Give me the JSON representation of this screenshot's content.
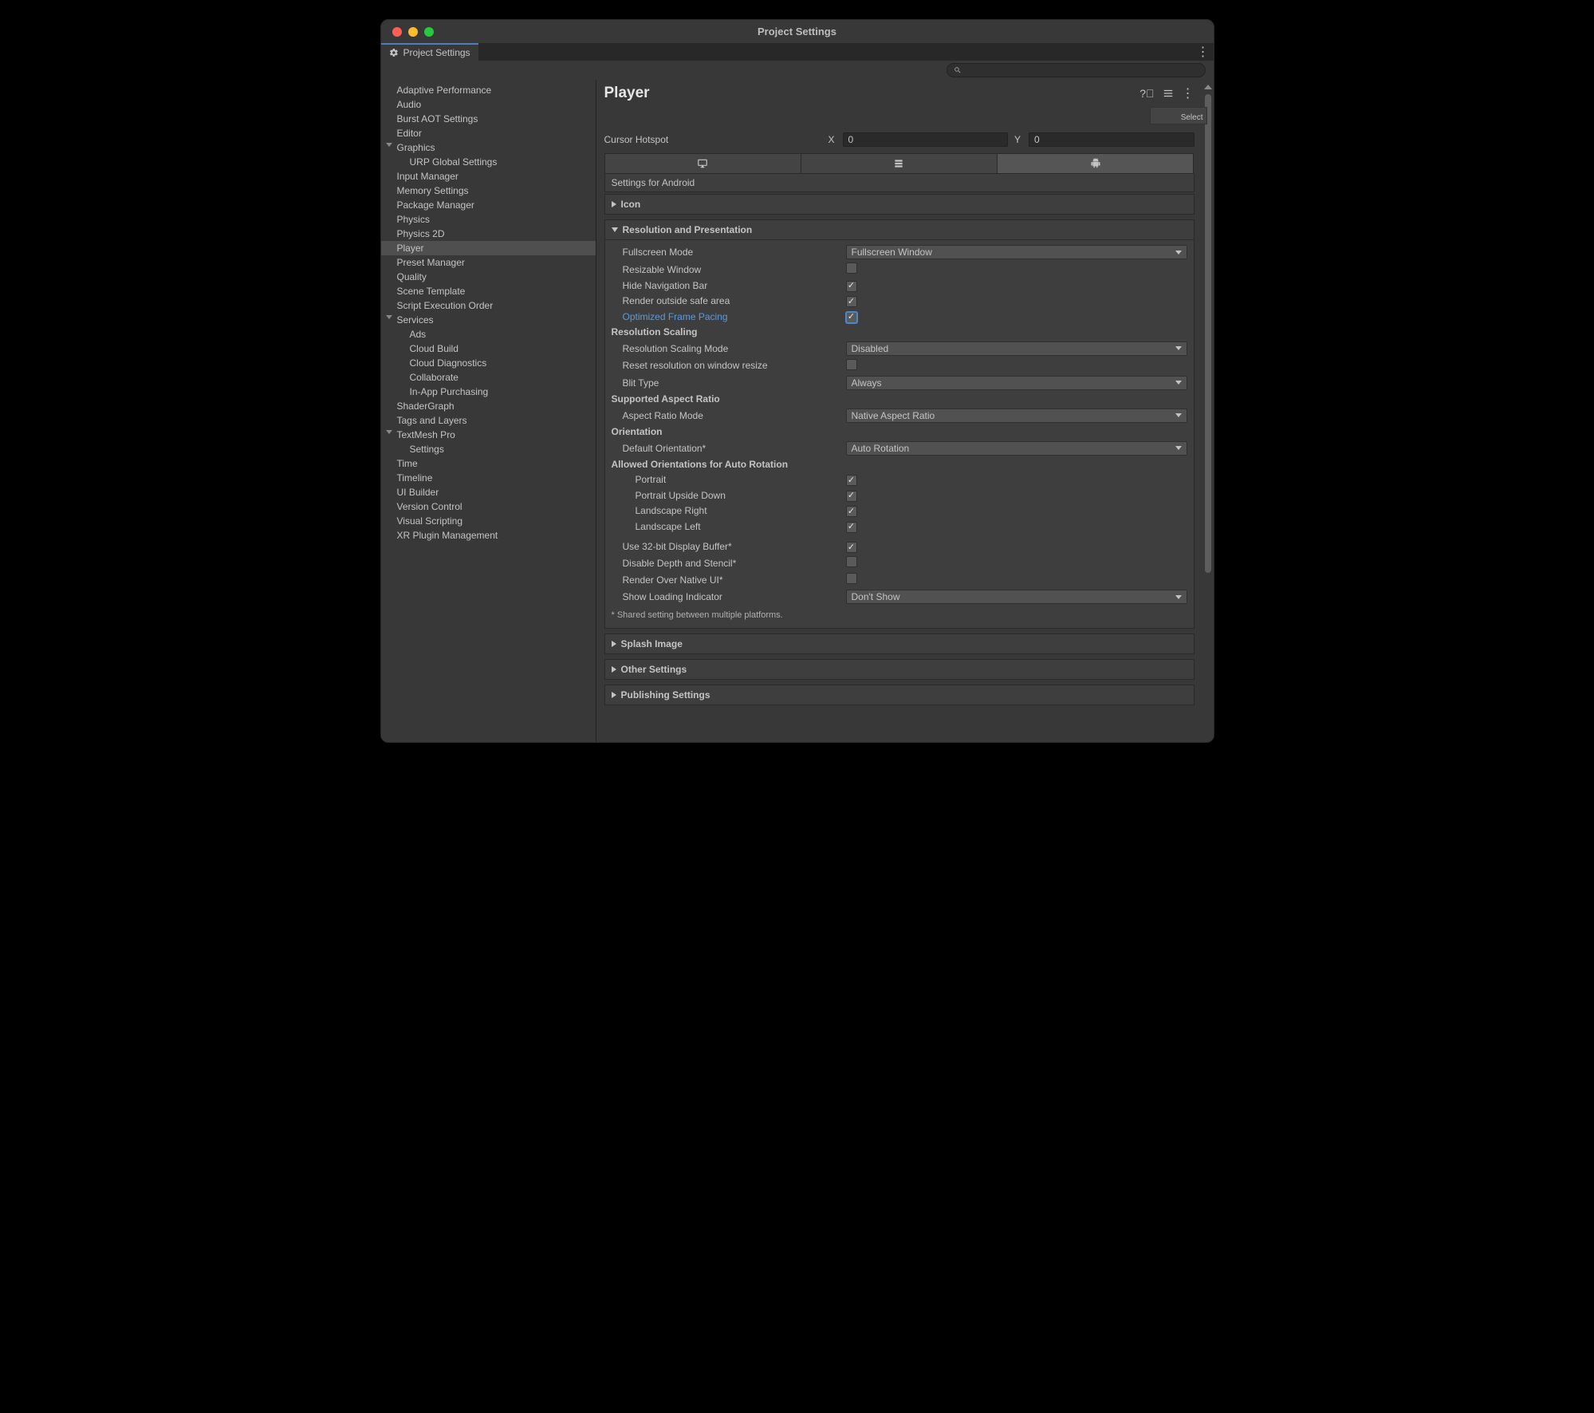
{
  "window": {
    "title": "Project Settings"
  },
  "tab": {
    "label": "Project Settings"
  },
  "sidebar": {
    "items": [
      {
        "label": "Adaptive Performance",
        "indent": 0
      },
      {
        "label": "Audio",
        "indent": 0
      },
      {
        "label": "Burst AOT Settings",
        "indent": 0
      },
      {
        "label": "Editor",
        "indent": 0
      },
      {
        "label": "Graphics",
        "indent": 0,
        "expandable": true
      },
      {
        "label": "URP Global Settings",
        "indent": 1
      },
      {
        "label": "Input Manager",
        "indent": 0
      },
      {
        "label": "Memory Settings",
        "indent": 0
      },
      {
        "label": "Package Manager",
        "indent": 0
      },
      {
        "label": "Physics",
        "indent": 0
      },
      {
        "label": "Physics 2D",
        "indent": 0
      },
      {
        "label": "Player",
        "indent": 0,
        "selected": true
      },
      {
        "label": "Preset Manager",
        "indent": 0
      },
      {
        "label": "Quality",
        "indent": 0
      },
      {
        "label": "Scene Template",
        "indent": 0
      },
      {
        "label": "Script Execution Order",
        "indent": 0
      },
      {
        "label": "Services",
        "indent": 0,
        "expandable": true
      },
      {
        "label": "Ads",
        "indent": 1
      },
      {
        "label": "Cloud Build",
        "indent": 1
      },
      {
        "label": "Cloud Diagnostics",
        "indent": 1
      },
      {
        "label": "Collaborate",
        "indent": 1
      },
      {
        "label": "In-App Purchasing",
        "indent": 1
      },
      {
        "label": "ShaderGraph",
        "indent": 0
      },
      {
        "label": "Tags and Layers",
        "indent": 0
      },
      {
        "label": "TextMesh Pro",
        "indent": 0,
        "expandable": true
      },
      {
        "label": "Settings",
        "indent": 1
      },
      {
        "label": "Time",
        "indent": 0
      },
      {
        "label": "Timeline",
        "indent": 0
      },
      {
        "label": "UI Builder",
        "indent": 0
      },
      {
        "label": "Version Control",
        "indent": 0
      },
      {
        "label": "Visual Scripting",
        "indent": 0
      },
      {
        "label": "XR Plugin Management",
        "indent": 0
      }
    ]
  },
  "main": {
    "title": "Player",
    "select_label": "Select",
    "cursor_hotspot": {
      "label": "Cursor Hotspot",
      "x_label": "X",
      "x_value": "0",
      "y_label": "Y",
      "y_value": "0"
    },
    "settings_for": "Settings for Android",
    "sections": {
      "icon": "Icon",
      "res": "Resolution and Presentation",
      "splash": "Splash Image",
      "other": "Other Settings",
      "publish": "Publishing Settings"
    },
    "res": {
      "fullscreen_mode": {
        "label": "Fullscreen Mode",
        "value": "Fullscreen Window"
      },
      "resizable_window": {
        "label": "Resizable Window",
        "checked": false
      },
      "hide_nav": {
        "label": "Hide Navigation Bar",
        "checked": true
      },
      "render_outside": {
        "label": "Render outside safe area",
        "checked": true
      },
      "opt_frame": {
        "label": "Optimized Frame Pacing",
        "checked": true,
        "highlight": true
      },
      "scaling_header": "Resolution Scaling",
      "scaling_mode": {
        "label": "Resolution Scaling Mode",
        "value": "Disabled"
      },
      "reset_res": {
        "label": "Reset resolution on window resize",
        "checked": false
      },
      "blit": {
        "label": "Blit Type",
        "value": "Always"
      },
      "aspect_header": "Supported Aspect Ratio",
      "aspect_mode": {
        "label": "Aspect Ratio Mode",
        "value": "Native Aspect Ratio"
      },
      "orient_header": "Orientation",
      "default_orient": {
        "label": "Default Orientation*",
        "value": "Auto Rotation"
      },
      "allowed_header": "Allowed Orientations for Auto Rotation",
      "portrait": {
        "label": "Portrait",
        "checked": true
      },
      "portrait_ud": {
        "label": "Portrait Upside Down",
        "checked": true
      },
      "land_r": {
        "label": "Landscape Right",
        "checked": true
      },
      "land_l": {
        "label": "Landscape Left",
        "checked": true
      },
      "use_32": {
        "label": "Use 32-bit Display Buffer*",
        "checked": true
      },
      "disable_depth": {
        "label": "Disable Depth and Stencil*",
        "checked": false
      },
      "render_over": {
        "label": "Render Over Native UI*",
        "checked": false
      },
      "loading": {
        "label": "Show Loading Indicator",
        "value": "Don't Show"
      },
      "footnote": "* Shared setting between multiple platforms."
    }
  }
}
